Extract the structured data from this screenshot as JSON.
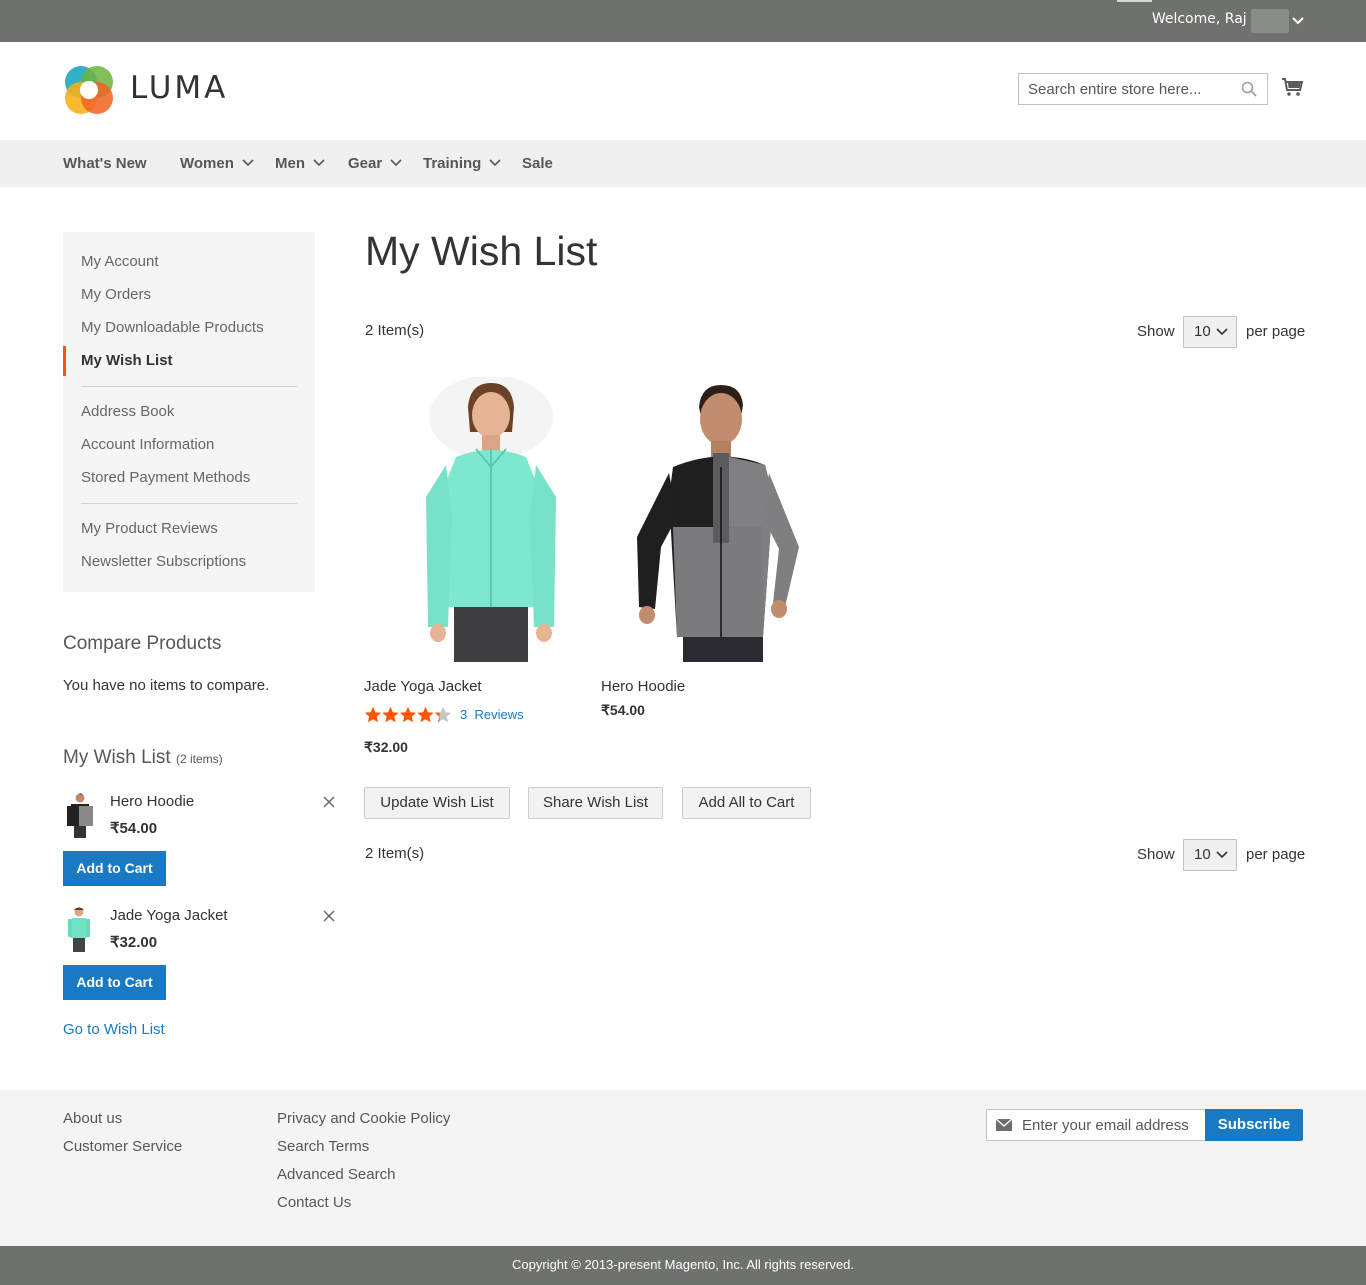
{
  "header": {
    "welcome": "Welcome, Raj S",
    "logo_text": "LUMA",
    "search_placeholder": "Search entire store here..."
  },
  "nav": [
    {
      "label": "What's New",
      "has_children": false
    },
    {
      "label": "Women",
      "has_children": true
    },
    {
      "label": "Men",
      "has_children": true
    },
    {
      "label": "Gear",
      "has_children": true
    },
    {
      "label": "Training",
      "has_children": true
    },
    {
      "label": "Sale",
      "has_children": false
    }
  ],
  "account_nav": {
    "items": [
      "My Account",
      "My Orders",
      "My Downloadable Products",
      "My Wish List",
      "Address Book",
      "Account Information",
      "Stored Payment Methods",
      "My Product Reviews",
      "Newsletter Subscriptions"
    ],
    "current": "My Wish List",
    "accent_color": "#ff5501"
  },
  "compare": {
    "title": "Compare Products",
    "empty_text": "You have no items to compare."
  },
  "sidebar_wishlist": {
    "title": "My Wish List",
    "count_text": "(2 items)",
    "items": [
      {
        "name": "Hero Hoodie",
        "price": "₹54.00",
        "button": "Add to Cart"
      },
      {
        "name": "Jade Yoga Jacket",
        "price": "₹32.00",
        "button": "Add to Cart"
      }
    ],
    "go_link": "Go to Wish List"
  },
  "main": {
    "title": "My Wish List",
    "items_count": "2 Item(s)",
    "show_label": "Show",
    "limit": "10",
    "per_page_label": "per page",
    "products": [
      {
        "name": "Jade Yoga Jacket",
        "price": "₹32.00",
        "rating_stars": 4.3,
        "reviews_count": "3",
        "reviews_label": "Reviews"
      },
      {
        "name": "Hero Hoodie",
        "price": "₹54.00"
      }
    ],
    "buttons": {
      "update": "Update Wish List",
      "share": "Share Wish List",
      "add_all": "Add All to Cart"
    }
  },
  "footer": {
    "col1": [
      "About us",
      "Customer Service"
    ],
    "col2": [
      "Privacy and Cookie Policy",
      "Search Terms",
      "Advanced Search",
      "Contact Us"
    ],
    "newsletter_placeholder": "Enter your email address",
    "subscribe": "Subscribe",
    "copyright": "Copyright © 2013-present Magento, Inc. All rights reserved."
  },
  "colors": {
    "primary": "#1979c3",
    "topbar": "#6e716e",
    "star": "#ff5501"
  }
}
